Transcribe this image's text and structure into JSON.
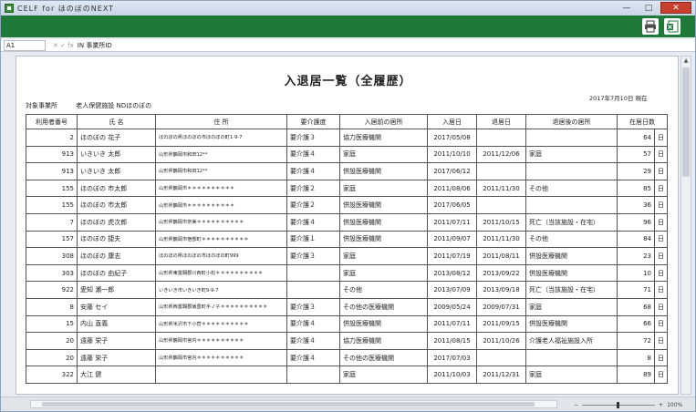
{
  "window": {
    "title": "CELF for ほのぼのNEXT"
  },
  "formula": {
    "cell_ref": "A1",
    "fx_icons": "✕ ✓ fx",
    "value": "IN 事業所ID"
  },
  "report": {
    "title": "入退居一覧（全履歴）",
    "date": "2017年7月10日 現在",
    "facility_label": "対象事業所",
    "facility_name": "老人保健施設 NDほのぼの",
    "day_unit": "日",
    "columns": [
      "利用者番号",
      "氏 名",
      "住 所",
      "要介護度",
      "入居前の居所",
      "入居日",
      "退居日",
      "退居後の居所",
      "在居日数"
    ],
    "rows": [
      {
        "id": "2",
        "name": "ほのぼの 花子",
        "address": "ほのぼの県ほのぼの市ほのぼの町1-9-7",
        "care": "要介護３",
        "before": "協力医療機関",
        "in": "2017/05/08",
        "out": "",
        "after": "",
        "days": "64"
      },
      {
        "id": "913",
        "name": "いきいき 太郎",
        "address": "山形県鶴岡市和田12**",
        "care": "要介護４",
        "before": "家庭",
        "in": "2011/10/10",
        "out": "2011/12/06",
        "after": "家庭",
        "days": "57"
      },
      {
        "id": "913",
        "name": "いきいき 太郎",
        "address": "山形県鶴岡市和田12**",
        "care": "要介護４",
        "before": "併設医療機関",
        "in": "2017/06/12",
        "out": "",
        "after": "",
        "days": "29"
      },
      {
        "id": "155",
        "name": "ほのぼの 市太郎",
        "address": "山形県鶴岡市＊＊＊＊＊＊＊＊＊＊",
        "care": "要介護２",
        "before": "家庭",
        "in": "2011/08/06",
        "out": "2011/11/30",
        "after": "その他",
        "days": "85"
      },
      {
        "id": "155",
        "name": "ほのぼの 市太郎",
        "address": "山形県鶴岡市＊＊＊＊＊＊＊＊＊＊",
        "care": "要介護２",
        "before": "併設医療機関",
        "in": "2017/06/05",
        "out": "",
        "after": "",
        "days": "36"
      },
      {
        "id": "7",
        "name": "ほのぼの 虎次郎",
        "address": "山形県鶴岡市奈美＊＊＊＊＊＊＊＊＊＊",
        "care": "要介護４",
        "before": "併設医療機関",
        "in": "2011/07/11",
        "out": "2011/10/15",
        "after": "死亡（当該施設・在宅）",
        "days": "96"
      },
      {
        "id": "157",
        "name": "ほのぼの 捷夫",
        "address": "山形県鶴岡市宿部町＊＊＊＊＊＊＊＊＊＊",
        "care": "要介護１",
        "before": "併設医療機関",
        "in": "2011/09/07",
        "out": "2011/11/30",
        "after": "その他",
        "days": "84"
      },
      {
        "id": "308",
        "name": "ほのぼの 康志",
        "address": "ほのぼの県ほのぼの市ほのぼの町999",
        "care": "要介護３",
        "before": "家庭",
        "in": "2011/07/19",
        "out": "2011/08/11",
        "after": "併設医療機関",
        "days": "23"
      },
      {
        "id": "303",
        "name": "ほのぼの 由紀子",
        "address": "山形県東置賜郡川西町小松＊＊＊＊＊＊＊＊＊＊",
        "care": "",
        "before": "家庭",
        "in": "2013/08/12",
        "out": "2013/09/22",
        "after": "併設医療機関",
        "days": "10"
      },
      {
        "id": "922",
        "name": "愛知 瀬一郎",
        "address": "いきいき市いきいき町9-9-7",
        "care": "",
        "before": "その他",
        "in": "2013/07/09",
        "out": "2013/09/18",
        "after": "死亡（当該施設・在宅）",
        "days": "71"
      },
      {
        "id": "8",
        "name": "安藤 セイ",
        "address": "山形県西置賜郡飯豊町手ノ子＊＊＊＊＊＊＊＊＊＊",
        "care": "要介護３",
        "before": "その他の医療機関",
        "in": "2009/05/24",
        "out": "2009/07/31",
        "after": "家庭",
        "days": "68"
      },
      {
        "id": "15",
        "name": "内山 直義",
        "address": "山形県米沢市下小菅＊＊＊＊＊＊＊＊＊＊",
        "care": "要介護４",
        "before": "併設医療機関",
        "in": "2011/07/11",
        "out": "2011/09/15",
        "after": "併設医療機関",
        "days": "66"
      },
      {
        "id": "20",
        "name": "遠藤 栄子",
        "address": "山形県鶴岡市宮内＊＊＊＊＊＊＊＊＊＊",
        "care": "要介護４",
        "before": "協力医療機関",
        "in": "2011/08/15",
        "out": "2011/10/26",
        "after": "介護老人福祉施設入所",
        "days": "72"
      },
      {
        "id": "20",
        "name": "遠藤 栄子",
        "address": "山形県鶴岡市宮内＊＊＊＊＊＊＊＊＊＊",
        "care": "要介護４",
        "before": "その他の医療機関",
        "in": "2017/07/03",
        "out": "",
        "after": "",
        "days": "8"
      },
      {
        "id": "322",
        "name": "大江 健",
        "address": "",
        "care": "",
        "before": "家庭",
        "in": "2011/10/03",
        "out": "2011/12/31",
        "after": "家庭",
        "days": "89"
      }
    ]
  },
  "status": {
    "zoom": "100%"
  }
}
